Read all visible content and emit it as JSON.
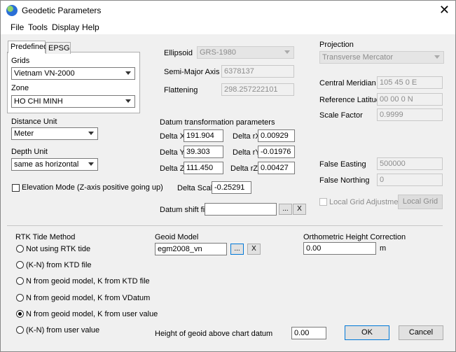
{
  "window": {
    "title": "Geodetic Parameters",
    "close_glyph": "✕"
  },
  "menu": [
    "File",
    "Tools",
    "Display",
    "Help"
  ],
  "tabs": [
    "Predefined",
    "EPSG"
  ],
  "grids": {
    "label": "Grids",
    "value": "Vietnam VN-2000"
  },
  "zone": {
    "label": "Zone",
    "value": "HO CHI MINH"
  },
  "distance_unit": {
    "label": "Distance Unit",
    "value": "Meter"
  },
  "depth_unit": {
    "label": "Depth Unit",
    "value": "same as horizontal"
  },
  "elevation_mode": {
    "label": "Elevation Mode (Z-axis positive going up)",
    "checked": false
  },
  "ellipsoid": {
    "label": "Ellipsoid",
    "value": "GRS-1980",
    "semi_major_label": "Semi-Major Axis",
    "semi_major": "6378137",
    "flattening_label": "Flattening",
    "flattening": "298.257222101"
  },
  "datum": {
    "title": "Datum transformation parameters",
    "delta_x_label": "Delta X",
    "delta_x": "191.904",
    "delta_y_label": "Delta Y",
    "delta_y": "39.303",
    "delta_z_label": "Delta Z",
    "delta_z": "111.450",
    "delta_rx_label": "Delta rX",
    "delta_rx": "0.00929",
    "delta_ry_label": "Delta rY",
    "delta_ry": "-0.01976",
    "delta_rz_label": "Delta rZ",
    "delta_rz": "0.00427",
    "delta_scale_label": "Delta Scale",
    "delta_scale": "-0.25291",
    "shift_file_label": "Datum shift file",
    "shift_file": "",
    "browse": "...",
    "clear": "X"
  },
  "projection": {
    "label": "Projection",
    "value": "Transverse Mercator",
    "central_meridian_label": "Central Meridian",
    "central_meridian": "105 45 0 E",
    "ref_lat_label": "Reference Latitude",
    "ref_lat": "00 00 0 N",
    "scale_factor_label": "Scale Factor",
    "scale_factor": "0.9999",
    "false_easting_label": "False Easting",
    "false_easting": "500000",
    "false_northing_label": "False Northing",
    "false_northing": "0",
    "local_grid_adj_label": "Local Grid Adjustment",
    "local_grid_button": "Local Grid"
  },
  "rtk": {
    "title": "RTK Tide Method",
    "options": [
      "Not using RTK tide",
      "(K-N) from KTD file",
      "N from geoid model, K from KTD file",
      "N from geoid model, K from VDatum",
      "N from geoid model, K from user value",
      "(K-N) from user value"
    ],
    "selected": "N from geoid model, K from user value"
  },
  "geoid": {
    "label": "Geoid Model",
    "value": "egm2008_vn",
    "browse": "...",
    "clear": "X"
  },
  "ortho": {
    "label": "Orthometric Height Correction",
    "value": "0.00",
    "unit": "m"
  },
  "geoid_height": {
    "label": "Height of geoid above chart datum",
    "value": "0.00"
  },
  "buttons": {
    "ok": "OK",
    "cancel": "Cancel"
  }
}
